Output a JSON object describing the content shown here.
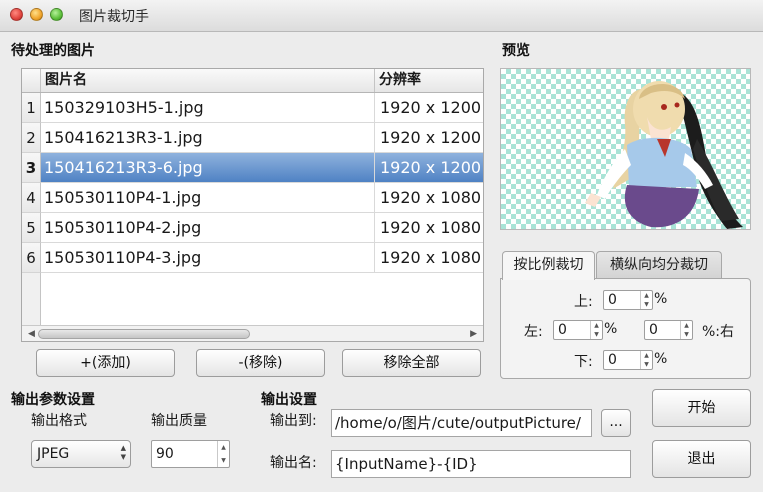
{
  "window": {
    "title": "图片裁切手"
  },
  "pending": {
    "label": "待处理的图片",
    "columns": [
      "图片名",
      "分辨率"
    ],
    "rows": [
      {
        "index": "1",
        "name": "150329103H5-1.jpg",
        "resolution": "1920 x 1200"
      },
      {
        "index": "2",
        "name": "150416213R3-1.jpg",
        "resolution": "1920 x 1200"
      },
      {
        "index": "3",
        "name": "150416213R3-6.jpg",
        "resolution": "1920 x 1200"
      },
      {
        "index": "4",
        "name": "150530110P4-1.jpg",
        "resolution": "1920 x 1080"
      },
      {
        "index": "5",
        "name": "150530110P4-2.jpg",
        "resolution": "1920 x 1080"
      },
      {
        "index": "6",
        "name": "150530110P4-3.jpg",
        "resolution": "1920 x 1080"
      }
    ],
    "selected_row": 3
  },
  "buttons": {
    "add": "+(添加)",
    "remove": "-(移除)",
    "remove_all": "移除全部",
    "start": "开始",
    "quit": "退出",
    "browse": "..."
  },
  "preview": {
    "label": "预览"
  },
  "tabs": {
    "ratio": "按比例裁切",
    "even": "横纵向均分裁切"
  },
  "crop": {
    "top_label": "上:",
    "top_value": "0",
    "left_label": "左:",
    "left_value": "0",
    "right_value": "0",
    "right_label": "%:右",
    "bottom_label": "下:",
    "bottom_value": "0",
    "percent": "%"
  },
  "output_params": {
    "label": "输出参数设置",
    "format_label": "输出格式",
    "format_value": "JPEG",
    "quality_label": "输出质量",
    "quality_value": "90"
  },
  "output_settings": {
    "label": "输出设置",
    "to_label": "输出到:",
    "to_value": "/home/o/图片/cute/outputPicture/",
    "name_label": "输出名:",
    "name_value": "{InputName}-{ID}"
  }
}
